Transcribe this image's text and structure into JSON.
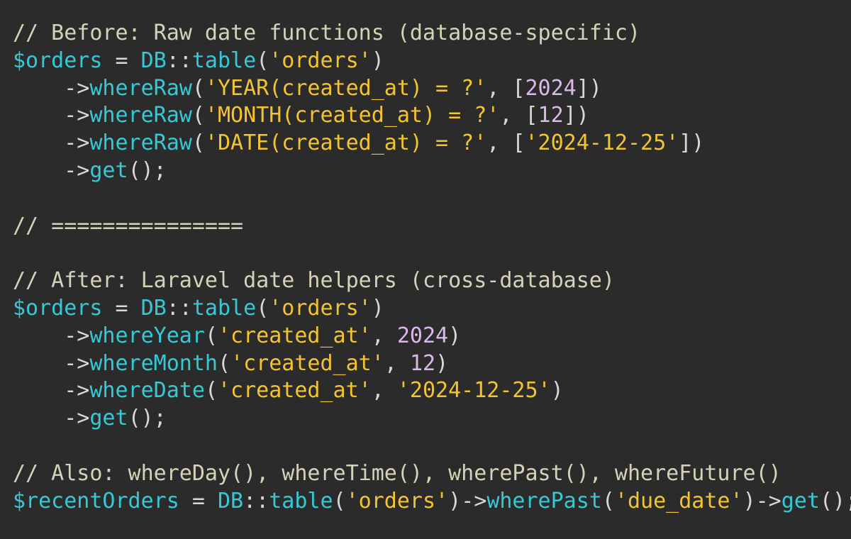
{
  "theme": {
    "background": "#2b2b2b",
    "comment": "#d6d2b8",
    "variable": "#35c9d6",
    "method": "#35c9d6",
    "string": "#f4c430",
    "number": "#dab8e8",
    "punctuation": "#d8d8d8"
  },
  "lines": [
    [
      {
        "t": "comment",
        "v": "// Before: Raw date functions (database-specific)"
      }
    ],
    [
      {
        "t": "var",
        "v": "$orders"
      },
      {
        "t": "op",
        "v": " = "
      },
      {
        "t": "class",
        "v": "DB"
      },
      {
        "t": "op",
        "v": "::"
      },
      {
        "t": "method",
        "v": "table"
      },
      {
        "t": "punct",
        "v": "("
      },
      {
        "t": "string",
        "v": "'orders'"
      },
      {
        "t": "punct",
        "v": ")"
      }
    ],
    [
      {
        "t": "plain",
        "v": "    "
      },
      {
        "t": "arrow",
        "v": "->"
      },
      {
        "t": "method",
        "v": "whereRaw"
      },
      {
        "t": "punct",
        "v": "("
      },
      {
        "t": "string",
        "v": "'YEAR(created_at) = ?'"
      },
      {
        "t": "punct",
        "v": ", ["
      },
      {
        "t": "number",
        "v": "2024"
      },
      {
        "t": "punct",
        "v": "])"
      }
    ],
    [
      {
        "t": "plain",
        "v": "    "
      },
      {
        "t": "arrow",
        "v": "->"
      },
      {
        "t": "method",
        "v": "whereRaw"
      },
      {
        "t": "punct",
        "v": "("
      },
      {
        "t": "string",
        "v": "'MONTH(created_at) = ?'"
      },
      {
        "t": "punct",
        "v": ", ["
      },
      {
        "t": "number",
        "v": "12"
      },
      {
        "t": "punct",
        "v": "])"
      }
    ],
    [
      {
        "t": "plain",
        "v": "    "
      },
      {
        "t": "arrow",
        "v": "->"
      },
      {
        "t": "method",
        "v": "whereRaw"
      },
      {
        "t": "punct",
        "v": "("
      },
      {
        "t": "string",
        "v": "'DATE(created_at) = ?'"
      },
      {
        "t": "punct",
        "v": ", ["
      },
      {
        "t": "string",
        "v": "'2024-12-25'"
      },
      {
        "t": "punct",
        "v": "])"
      }
    ],
    [
      {
        "t": "plain",
        "v": "    "
      },
      {
        "t": "arrow",
        "v": "->"
      },
      {
        "t": "method",
        "v": "get"
      },
      {
        "t": "punct",
        "v": "();"
      }
    ],
    [],
    [
      {
        "t": "comment",
        "v": "// ==============="
      }
    ],
    [],
    [
      {
        "t": "comment",
        "v": "// After: Laravel date helpers (cross-database)"
      }
    ],
    [
      {
        "t": "var",
        "v": "$orders"
      },
      {
        "t": "op",
        "v": " = "
      },
      {
        "t": "class",
        "v": "DB"
      },
      {
        "t": "op",
        "v": "::"
      },
      {
        "t": "method",
        "v": "table"
      },
      {
        "t": "punct",
        "v": "("
      },
      {
        "t": "string",
        "v": "'orders'"
      },
      {
        "t": "punct",
        "v": ")"
      }
    ],
    [
      {
        "t": "plain",
        "v": "    "
      },
      {
        "t": "arrow",
        "v": "->"
      },
      {
        "t": "method",
        "v": "whereYear"
      },
      {
        "t": "punct",
        "v": "("
      },
      {
        "t": "string",
        "v": "'created_at'"
      },
      {
        "t": "punct",
        "v": ", "
      },
      {
        "t": "number",
        "v": "2024"
      },
      {
        "t": "punct",
        "v": ")"
      }
    ],
    [
      {
        "t": "plain",
        "v": "    "
      },
      {
        "t": "arrow",
        "v": "->"
      },
      {
        "t": "method",
        "v": "whereMonth"
      },
      {
        "t": "punct",
        "v": "("
      },
      {
        "t": "string",
        "v": "'created_at'"
      },
      {
        "t": "punct",
        "v": ", "
      },
      {
        "t": "number",
        "v": "12"
      },
      {
        "t": "punct",
        "v": ")"
      }
    ],
    [
      {
        "t": "plain",
        "v": "    "
      },
      {
        "t": "arrow",
        "v": "->"
      },
      {
        "t": "method",
        "v": "whereDate"
      },
      {
        "t": "punct",
        "v": "("
      },
      {
        "t": "string",
        "v": "'created_at'"
      },
      {
        "t": "punct",
        "v": ", "
      },
      {
        "t": "string",
        "v": "'2024-12-25'"
      },
      {
        "t": "punct",
        "v": ")"
      }
    ],
    [
      {
        "t": "plain",
        "v": "    "
      },
      {
        "t": "arrow",
        "v": "->"
      },
      {
        "t": "method",
        "v": "get"
      },
      {
        "t": "punct",
        "v": "();"
      }
    ],
    [],
    [
      {
        "t": "comment",
        "v": "// Also: whereDay(), whereTime(), wherePast(), whereFuture()"
      }
    ],
    [
      {
        "t": "var",
        "v": "$recentOrders"
      },
      {
        "t": "op",
        "v": " = "
      },
      {
        "t": "class",
        "v": "DB"
      },
      {
        "t": "op",
        "v": "::"
      },
      {
        "t": "method",
        "v": "table"
      },
      {
        "t": "punct",
        "v": "("
      },
      {
        "t": "string",
        "v": "'orders'"
      },
      {
        "t": "punct",
        "v": ")"
      },
      {
        "t": "arrow",
        "v": "->"
      },
      {
        "t": "method",
        "v": "wherePast"
      },
      {
        "t": "punct",
        "v": "("
      },
      {
        "t": "string",
        "v": "'due_date'"
      },
      {
        "t": "punct",
        "v": ")"
      },
      {
        "t": "arrow",
        "v": "->"
      },
      {
        "t": "method",
        "v": "get"
      },
      {
        "t": "punct",
        "v": "();"
      }
    ]
  ]
}
